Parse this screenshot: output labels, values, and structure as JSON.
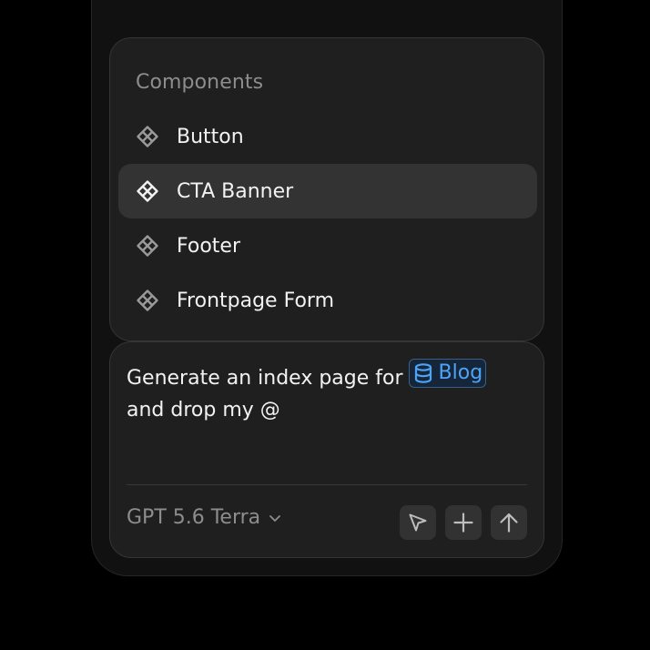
{
  "menu": {
    "heading": "Components",
    "items": [
      {
        "label": "Button",
        "icon": "component-icon",
        "selected": false
      },
      {
        "label": "CTA Banner",
        "icon": "component-icon",
        "selected": true
      },
      {
        "label": "Footer",
        "icon": "component-icon",
        "selected": false
      },
      {
        "label": "Frontpage Form",
        "icon": "component-icon",
        "selected": false
      }
    ]
  },
  "composer": {
    "prompt_before": "Generate an index page for",
    "mention": {
      "label": "Blog",
      "icon": "database-icon",
      "color": "#4fa3f5"
    },
    "prompt_after": "and drop my @",
    "model": "GPT 5.6 Terra",
    "actions": [
      {
        "name": "cursor-icon"
      },
      {
        "name": "plus-icon"
      },
      {
        "name": "arrow-up-icon"
      }
    ]
  },
  "colors": {
    "background": "#000000",
    "panel": "#1f1f1f",
    "selected_row": "#333333",
    "accent": "#4fa3f5"
  }
}
